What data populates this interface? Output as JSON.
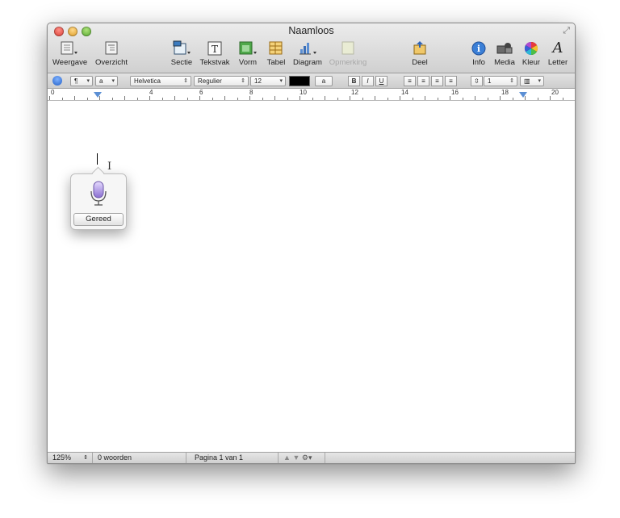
{
  "window": {
    "title": "Naamloos"
  },
  "toolbar": {
    "items": [
      {
        "id": "weergave",
        "label": "Weergave",
        "icon": "view-icon"
      },
      {
        "id": "overzicht",
        "label": "Overzicht",
        "icon": "outline-icon"
      },
      {
        "id": "sectie",
        "label": "Sectie",
        "icon": "section-icon"
      },
      {
        "id": "tekstvak",
        "label": "Tekstvak",
        "icon": "textbox-icon"
      },
      {
        "id": "vorm",
        "label": "Vorm",
        "icon": "shape-icon"
      },
      {
        "id": "tabel",
        "label": "Tabel",
        "icon": "table-icon"
      },
      {
        "id": "diagram",
        "label": "Diagram",
        "icon": "chart-icon"
      },
      {
        "id": "opmerking",
        "label": "Opmerking",
        "icon": "comment-icon",
        "disabled": true
      },
      {
        "id": "deel",
        "label": "Deel",
        "icon": "share-icon"
      },
      {
        "id": "info",
        "label": "Info",
        "icon": "info-icon"
      },
      {
        "id": "media",
        "label": "Media",
        "icon": "media-icon"
      },
      {
        "id": "kleur",
        "label": "Kleur",
        "icon": "color-wheel-icon"
      },
      {
        "id": "letter",
        "label": "Letter",
        "icon": "font-icon"
      }
    ]
  },
  "format": {
    "paragraph_style": "¶",
    "char_style": "a",
    "font_family": "Helvetica",
    "font_style": "Regulier",
    "font_size": "12",
    "text_color": "#000000",
    "highlight_label": "a",
    "bold": "B",
    "italic": "I",
    "underline": "U",
    "line_spacing": "1"
  },
  "ruler": {
    "numbers": [
      "0",
      "4",
      "6",
      "8",
      "10",
      "12",
      "14",
      "16",
      "18",
      "20"
    ]
  },
  "dictation": {
    "done_label": "Gereed"
  },
  "status": {
    "zoom": "125%",
    "word_count": "0 woorden",
    "page": "Pagina 1 van 1"
  }
}
